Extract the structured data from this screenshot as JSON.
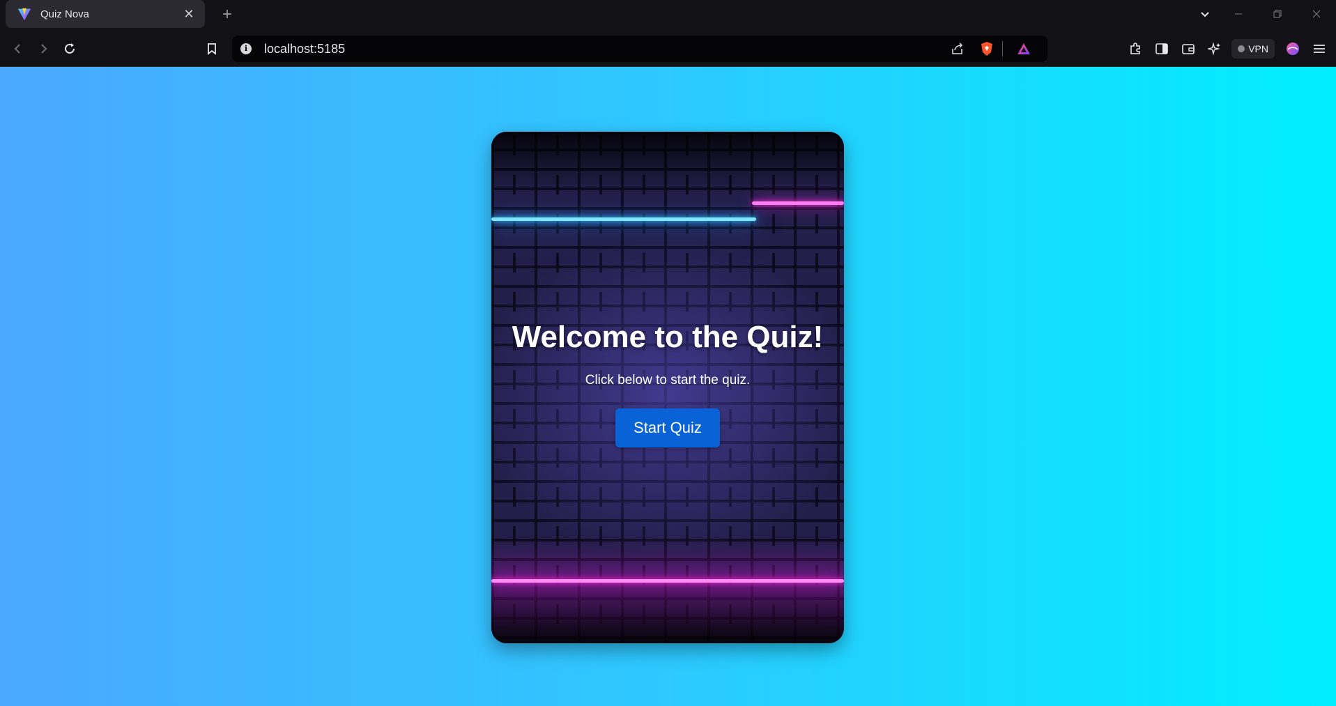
{
  "browser": {
    "tab": {
      "title": "Quiz Nova",
      "favicon": "vite-logo-icon"
    },
    "new_tab_symbol": "+",
    "url": "localhost:5185",
    "vpn_label": "VPN"
  },
  "page": {
    "title": "Welcome to the Quiz!",
    "subtitle": "Click below to start the quiz.",
    "start_button": "Start Quiz"
  },
  "colors": {
    "bg_gradient_start": "#4aa8ff",
    "bg_gradient_end": "#00eeff",
    "button": "#0a63d6",
    "neon_cyan": "#7fe6ff",
    "neon_pink": "#ff7cf0"
  }
}
